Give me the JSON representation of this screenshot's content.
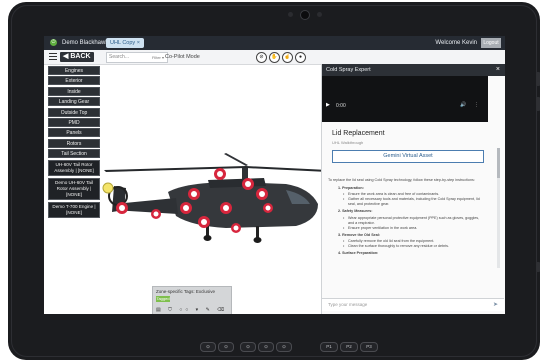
{
  "topbar": {
    "app_name": "Demo Blackhawk",
    "tab_label": "UHL Copy ×",
    "welcome": "Welcome Kevin",
    "user_button": "Logout"
  },
  "toolbar": {
    "back_label": "◀ BACK",
    "search_placeholder": "Search...",
    "search_filter": "Filter ▾",
    "copilot_label": "Co-Pilot Mode"
  },
  "sidebar": {
    "items": [
      "Engines",
      "Exterior",
      "Inside",
      "Landing Gear",
      "Outside Top",
      "PMD",
      "Panels",
      "Rotors",
      "Tail Section"
    ],
    "groups": [
      "UH-60V Tail Rotor Assembly | [NONE]",
      "Demo UH-60V Tail Rotor Assembly | [NONE]",
      "Demo T-700 Engine | [NONE]"
    ]
  },
  "bottom_panel": {
    "title": "Zone-specific Tags: Exclusive",
    "tag": "Tagged",
    "icons": "▤ ⛉ ○○ ▾ ✎ ⌫"
  },
  "right_panel": {
    "header": "Cold Spray Expert",
    "close": "×",
    "video_time": "0:00",
    "video_icons": "🔊 ⋮",
    "title": "Lid Replacement",
    "subtitle": "UHL Walkthrough",
    "asset_button": "Gemini Virtual Asset",
    "intro": "To replace the lid seal using Cold Spray technology, follow these step-by-step instructions:",
    "steps": [
      {
        "title": "1. Preparation:",
        "items": [
          "Ensure the work area is clean and free of contaminants.",
          "Gather all necessary tools and materials, including the Cold Spray equipment, lid seal, and protective gear."
        ]
      },
      {
        "title": "2. Safety Measures:",
        "items": [
          "Wear appropriate personal protective equipment (PPE) such as gloves, goggles, and a respirator.",
          "Ensure proper ventilation in the work area."
        ]
      },
      {
        "title": "3. Remove the Old Seal:",
        "items": [
          "Carefully remove the old lid seal from the equipment.",
          "Clean the surface thoroughly to remove any residue or debris."
        ]
      },
      {
        "title": "4. Surface Preparation:",
        "items": []
      }
    ],
    "input_placeholder": "Type your message",
    "send_icon": "➤"
  },
  "hardware_buttons": [
    "⊙",
    "⊙",
    "⊙",
    "⊙",
    "⊙",
    "P1",
    "P2",
    "P3"
  ],
  "colors": {
    "accent": "#4c7db0",
    "power_green": "#5fae3f",
    "marker_red": "#d7263d",
    "dark_bar": "#262b33"
  }
}
